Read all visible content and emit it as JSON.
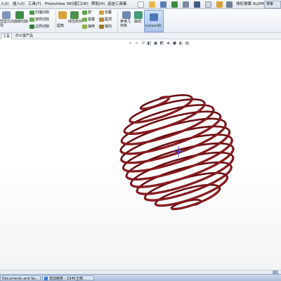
{
  "menubar": {
    "items": [
      "入(I)",
      "插入(I)",
      "工具(T)",
      "PhotoView 360",
      "窗口(W)",
      "帮助(H)",
      "巡迹工具集"
    ],
    "file_title": "球形弹簧.SLDPRT",
    "title_box": "搜索"
  },
  "ribbon": {
    "btn_hole_wizard": "异型孔向导",
    "btn_revolve_cut": "旋转切除",
    "btn_sweep_cut": "扫描切除",
    "btn_loft_cut": "放样切除",
    "btn_boundary_cut": "边界切除",
    "btn_fillet": "圆角",
    "btn_linear_pattern": "线性阵列",
    "btn_rib": "筋",
    "btn_draft": "拔模",
    "btn_shell": "抽壳",
    "btn_wrap": "包覆",
    "btn_intersect": "圆顶",
    "btn_mirror": "镜向",
    "btn_ref_geometry": "参考几何体",
    "btn_curves": "曲线",
    "btn_instant3d": "Instant3D"
  },
  "tabs": [
    "工具",
    "办公室产品"
  ],
  "taskbar": {
    "task1": "Documents and Se...",
    "task2": "增加链表 - 2345王牌..."
  },
  "colors": {
    "spring": "#6b0f12",
    "spring_highlight": "#b3262b",
    "ribbon_bg": "#e9eef5"
  }
}
